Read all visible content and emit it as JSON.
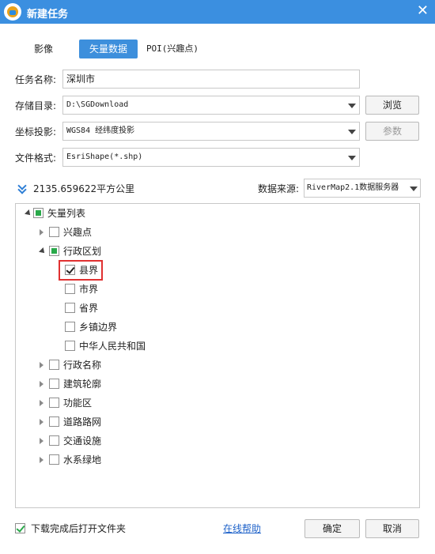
{
  "window": {
    "title": "新建任务",
    "close_icon": "close-icon"
  },
  "tabs": [
    {
      "label": "影像",
      "active": false
    },
    {
      "label": "矢量数据",
      "active": true
    },
    {
      "label": "POI(兴趣点)",
      "active": false
    }
  ],
  "form": {
    "task_name": {
      "label": "任务名称:",
      "value": "深圳市"
    },
    "storage_dir": {
      "label": "存储目录:",
      "value": "D:\\SGDownload",
      "browse_label": "浏览"
    },
    "projection": {
      "label": "坐标投影:",
      "value": "WGS84 经纬度投影",
      "params_label": "参数"
    },
    "file_format": {
      "label": "文件格式:",
      "value": "EsriShape(*.shp)"
    }
  },
  "area": {
    "icon": "double-chevron-down-icon",
    "text": "2135.659622平方公里"
  },
  "data_source": {
    "label": "数据来源:",
    "value": "RiverMap2.1数据服务器"
  },
  "tree": {
    "root": {
      "label": "矢量列表",
      "state": "partial",
      "expanded": true
    },
    "items": [
      {
        "label": "兴趣点",
        "state": "unchecked",
        "expanded": false
      },
      {
        "label": "行政区划",
        "state": "partial",
        "expanded": true,
        "children": [
          {
            "label": "县界",
            "state": "checked"
          },
          {
            "label": "市界",
            "state": "unchecked"
          },
          {
            "label": "省界",
            "state": "unchecked"
          },
          {
            "label": "乡镇边界",
            "state": "unchecked"
          },
          {
            "label": "中华人民共和国",
            "state": "unchecked"
          }
        ]
      },
      {
        "label": "行政名称",
        "state": "unchecked",
        "expanded": false
      },
      {
        "label": "建筑轮廓",
        "state": "unchecked",
        "expanded": false
      },
      {
        "label": "功能区",
        "state": "unchecked",
        "expanded": false
      },
      {
        "label": "道路路网",
        "state": "unchecked",
        "expanded": false
      },
      {
        "label": "交通设施",
        "state": "unchecked",
        "expanded": false
      },
      {
        "label": "水系绿地",
        "state": "unchecked",
        "expanded": false
      }
    ]
  },
  "footer": {
    "open_folder_label": "下载完成后打开文件夹",
    "open_folder_checked": true,
    "help_link": "在线帮助",
    "ok_label": "确定",
    "cancel_label": "取消"
  },
  "colors": {
    "title_bar": "#3b8fe0",
    "active_tab": "#3d8fdc",
    "highlight": "#e03131",
    "partial_check": "#29a94a"
  }
}
